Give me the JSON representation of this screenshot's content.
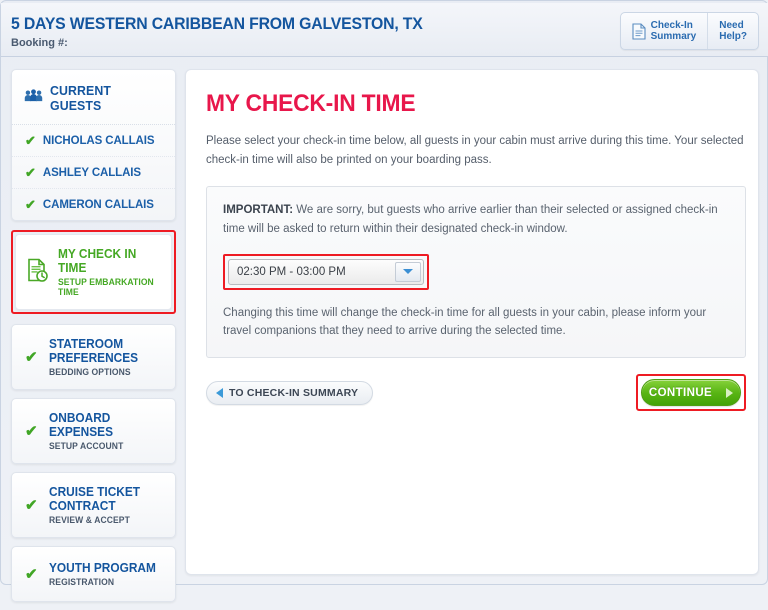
{
  "header": {
    "cruise_title": "5 DAYS WESTERN CARIBBEAN FROM GALVESTON, TX",
    "booking_label": "Booking #:",
    "actions": [
      {
        "label": "Check-In\nSummary",
        "icon": "document-icon"
      },
      {
        "label": "Need\nHelp?",
        "icon": ""
      }
    ]
  },
  "sidebar": {
    "guests_card": {
      "title": "CURRENT GUESTS",
      "icon": "guests-group-icon",
      "guests": [
        {
          "name": "NICHOLAS CALLAIS",
          "check": "✔"
        },
        {
          "name": "ASHLEY CALLAIS",
          "check": "✔"
        },
        {
          "name": "CAMERON CALLAIS",
          "check": "✔"
        }
      ]
    },
    "nav_items": [
      {
        "title": "MY CHECK IN TIME",
        "subtitle": "SETUP EMBARKATION TIME",
        "icon": "document-clock-icon",
        "active": true,
        "check": ""
      },
      {
        "title": "STATEROOM PREFERENCES",
        "subtitle": "BEDDING OPTIONS",
        "icon": "check-icon",
        "active": false,
        "check": "✔"
      },
      {
        "title": "ONBOARD EXPENSES",
        "subtitle": "SETUP ACCOUNT",
        "icon": "check-icon",
        "active": false,
        "check": "✔"
      },
      {
        "title": "CRUISE TICKET CONTRACT",
        "subtitle": "REVIEW & ACCEPT",
        "icon": "check-icon",
        "active": false,
        "check": "✔"
      },
      {
        "title": "YOUTH PROGRAM",
        "subtitle": "REGISTRATION",
        "icon": "check-icon",
        "active": false,
        "check": "✔"
      }
    ]
  },
  "main": {
    "title": "MY CHECK-IN TIME",
    "intro": "Please select your check-in time below, all guests in your cabin must arrive during this time.   Your selected check-in time will also be printed on your boarding pass.",
    "important_label": "IMPORTANT:",
    "important_text": " We are sorry, but guests who arrive earlier than their selected or assigned check-in time will be asked to return within their designated check-in window.",
    "time_select": {
      "selected": "02:30 PM - 03:00 PM",
      "arrow_icon": "chevron-down-icon"
    },
    "changing_text": "Changing this time will change the check-in time for all guests in your cabin, please inform your travel companions that they need to arrive during the selected time.",
    "back_button": {
      "label": "TO CHECK-IN SUMMARY",
      "icon": "arrow-left-icon"
    },
    "continue_button": {
      "label": "CONTINUE",
      "icon": "arrow-right-icon"
    }
  },
  "colors": {
    "brand_blue": "#14559e",
    "accent_red": "#e8174b",
    "highlight_red": "#ee1b23",
    "green": "#45a824",
    "continue_green": "#58b514"
  }
}
